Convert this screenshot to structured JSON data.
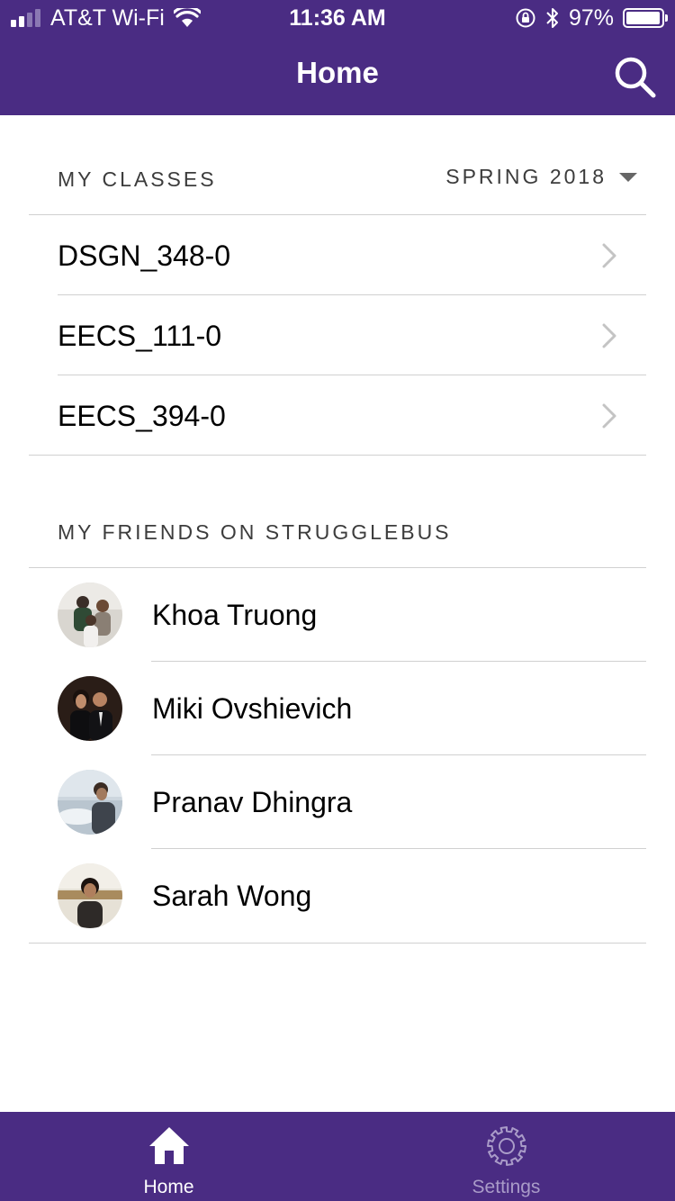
{
  "status_bar": {
    "carrier": "AT&T Wi-Fi",
    "time": "11:36 AM",
    "battery": "97%",
    "battery_level": 0.97
  },
  "header": {
    "title": "Home",
    "search_icon": "search-icon"
  },
  "classes": {
    "header": "MY CLASSES",
    "semester": "SPRING 2018",
    "items": [
      {
        "label": "DSGN_348-0"
      },
      {
        "label": "EECS_111-0"
      },
      {
        "label": "EECS_394-0"
      }
    ]
  },
  "friends": {
    "header": "MY FRIENDS ON STRUGGLEBUS",
    "items": [
      {
        "name": "Khoa Truong"
      },
      {
        "name": "Miki Ovshievich"
      },
      {
        "name": "Pranav Dhingra"
      },
      {
        "name": "Sarah Wong"
      }
    ]
  },
  "tabbar": {
    "tabs": [
      {
        "label": "Home",
        "icon": "home-icon",
        "active": true
      },
      {
        "label": "Settings",
        "icon": "gear-icon",
        "active": false
      }
    ]
  },
  "colors": {
    "brand": "#4a2c83",
    "tab_inactive": "#a99bc8",
    "divider": "#d0d0d0"
  }
}
